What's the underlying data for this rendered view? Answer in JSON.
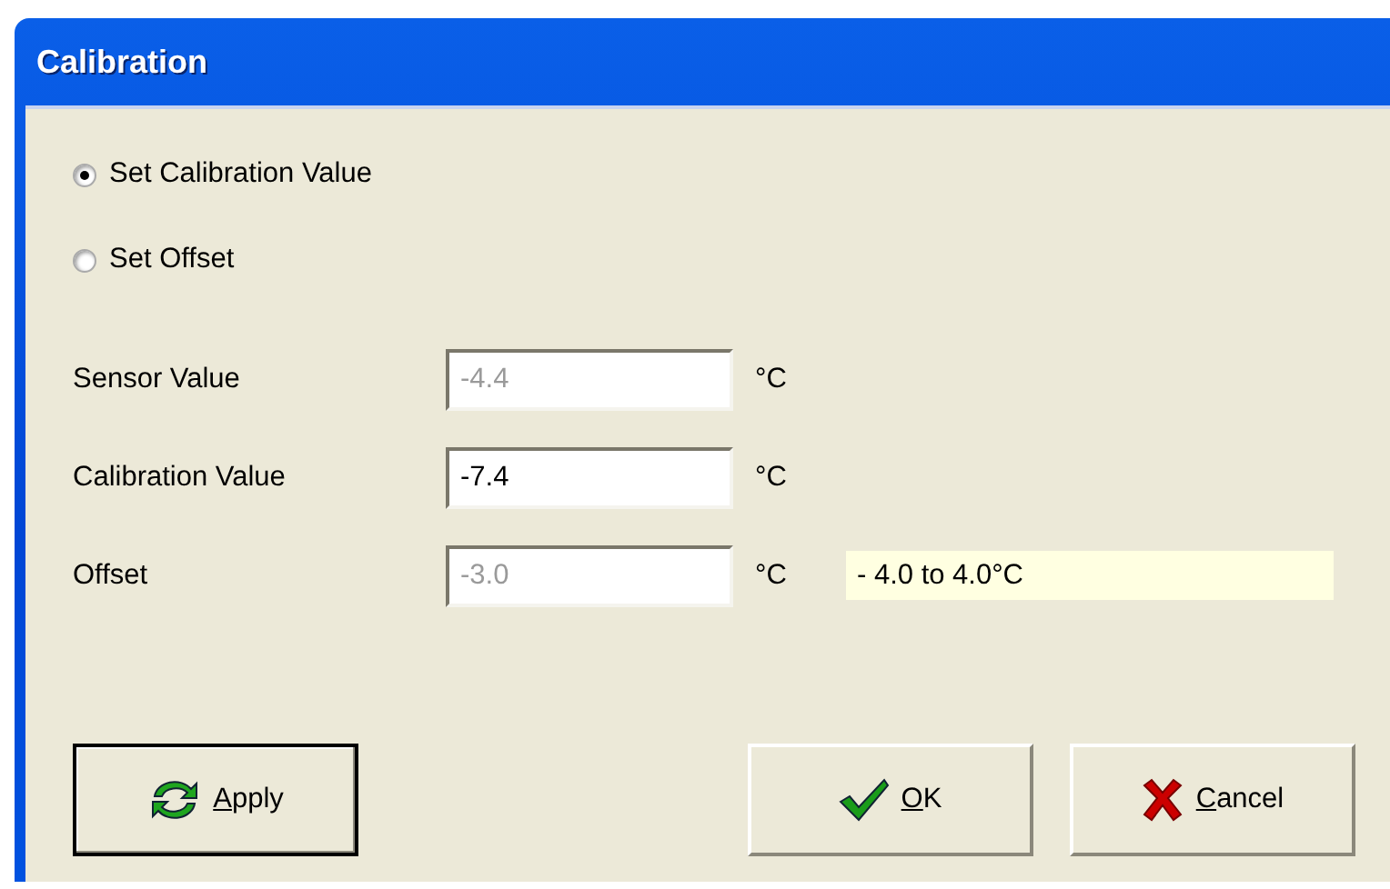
{
  "window": {
    "title": "Calibration"
  },
  "options": [
    {
      "label": "Set Calibration Value",
      "selected": true
    },
    {
      "label": "Set Offset",
      "selected": false
    }
  ],
  "fields": [
    {
      "label": "Sensor Value",
      "value": "-4.4",
      "unit": "°C",
      "disabled": true
    },
    {
      "label": "Calibration Value",
      "value": "-7.4",
      "unit": "°C",
      "disabled": false
    },
    {
      "label": "Offset",
      "value": "-3.0",
      "unit": "°C",
      "disabled": true
    }
  ],
  "range_hint": "- 4.0 to 4.0°C",
  "buttons": [
    {
      "label": "Apply",
      "kind": "refresh",
      "default": true,
      "mnemonic_underlined": true
    },
    {
      "label": "OK",
      "kind": "check",
      "default": false,
      "mnemonic_underlined": true
    },
    {
      "label": "Cancel",
      "kind": "cross",
      "default": false,
      "mnemonic_underlined": true
    }
  ]
}
